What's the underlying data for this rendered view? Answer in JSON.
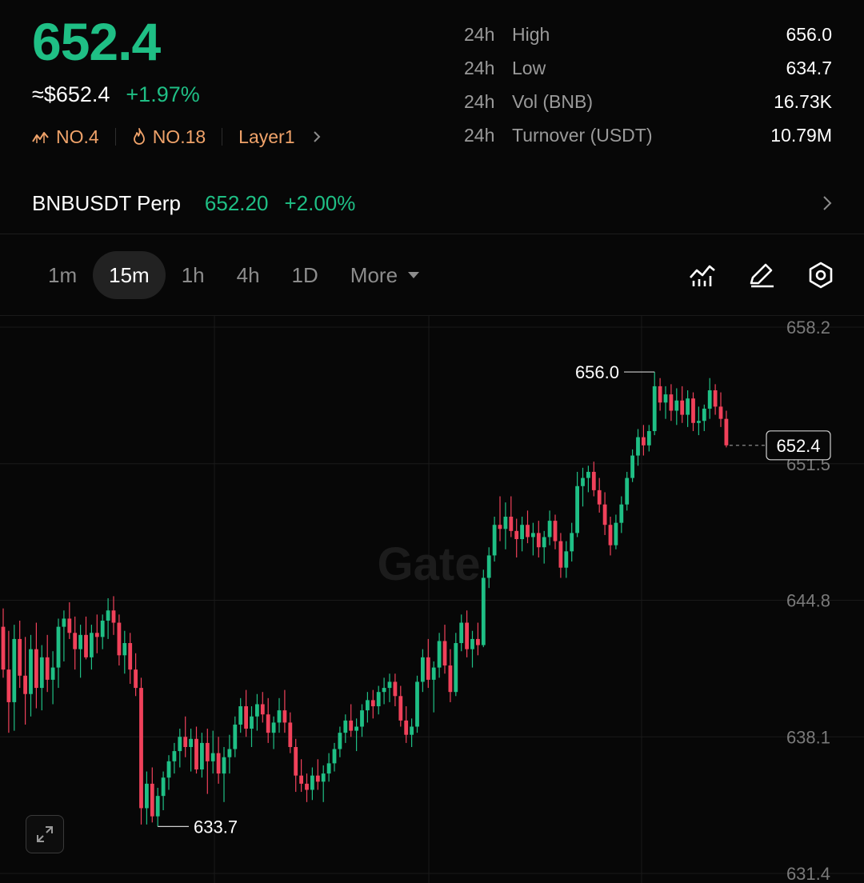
{
  "ticker": {
    "last_price": "652.4",
    "fiat_price": "≈$652.4",
    "change_pct": "+1.97%",
    "rank_market_cap": "NO.4",
    "rank_hot": "NO.18",
    "category": "Layer1"
  },
  "stats": [
    {
      "period": "24h",
      "label": "High",
      "value": "656.0"
    },
    {
      "period": "24h",
      "label": "Low",
      "value": "634.7"
    },
    {
      "period": "24h",
      "label": "Vol (BNB)",
      "value": "16.73K"
    },
    {
      "period": "24h",
      "label": "Turnover (USDT)",
      "value": "10.79M"
    }
  ],
  "perp": {
    "name": "BNBUSDT Perp",
    "price": "652.20",
    "change": "+2.00%"
  },
  "timeframes": {
    "items": [
      "1m",
      "15m",
      "1h",
      "4h",
      "1D"
    ],
    "active": "15m",
    "more_label": "More"
  },
  "tools": [
    "indicators-icon",
    "draw-icon",
    "settings-icon"
  ],
  "colors": {
    "up": "#1fbf85",
    "down": "#f0415a",
    "rank_orange": "#f0a36a",
    "background": "#070707"
  },
  "chart_data": {
    "type": "candlestick",
    "timeframe": "15m",
    "watermark": "Gate",
    "y_ticks": [
      "658.2",
      "651.5",
      "644.8",
      "638.1",
      "631.4"
    ],
    "ylim": [
      631.4,
      658.2
    ],
    "high_marker": "656.0",
    "low_marker": "633.7",
    "last_price_label": "652.4",
    "last_price": 652.4,
    "candles": [
      [
        643.5,
        644.4,
        641.0,
        641.4
      ],
      [
        641.4,
        643.3,
        638.3,
        639.8
      ],
      [
        639.8,
        643.6,
        638.4,
        642.9
      ],
      [
        642.9,
        643.8,
        640.5,
        641.1
      ],
      [
        641.1,
        643.0,
        638.7,
        640.2
      ],
      [
        640.2,
        643.1,
        639.1,
        642.4
      ],
      [
        642.4,
        643.7,
        639.5,
        640.5
      ],
      [
        640.5,
        642.6,
        639.4,
        642.0
      ],
      [
        642.0,
        643.1,
        640.3,
        640.9
      ],
      [
        640.9,
        642.3,
        639.7,
        641.5
      ],
      [
        641.5,
        643.9,
        640.5,
        643.5
      ],
      [
        643.5,
        644.3,
        641.8,
        643.9
      ],
      [
        643.9,
        644.7,
        642.9,
        643.2
      ],
      [
        643.2,
        644.0,
        641.4,
        642.4
      ],
      [
        642.4,
        643.6,
        641.0,
        643.1
      ],
      [
        643.1,
        644.0,
        641.9,
        642.0
      ],
      [
        642.0,
        643.6,
        641.4,
        643.2
      ],
      [
        643.2,
        644.1,
        642.2,
        643.0
      ],
      [
        643.0,
        644.1,
        642.4,
        643.8
      ],
      [
        643.8,
        644.9,
        642.9,
        644.3
      ],
      [
        644.3,
        645.0,
        643.1,
        643.7
      ],
      [
        643.7,
        644.1,
        641.6,
        642.1
      ],
      [
        642.1,
        643.3,
        641.2,
        642.7
      ],
      [
        642.7,
        643.2,
        640.7,
        641.4
      ],
      [
        641.4,
        642.2,
        640.1,
        640.5
      ],
      [
        640.5,
        641.0,
        633.8,
        634.6
      ],
      [
        634.6,
        636.4,
        633.8,
        635.8
      ],
      [
        635.8,
        636.6,
        633.9,
        634.2
      ],
      [
        634.2,
        635.6,
        633.7,
        635.2
      ],
      [
        635.2,
        636.4,
        634.5,
        636.1
      ],
      [
        636.1,
        637.2,
        635.5,
        636.9
      ],
      [
        636.9,
        637.8,
        636.3,
        637.4
      ],
      [
        637.4,
        638.5,
        636.6,
        638.1
      ],
      [
        638.1,
        639.1,
        637.1,
        637.6
      ],
      [
        637.6,
        638.5,
        636.4,
        638.0
      ],
      [
        638.0,
        638.6,
        636.3,
        636.5
      ],
      [
        636.5,
        638.3,
        636.1,
        637.8
      ],
      [
        637.8,
        638.5,
        635.3,
        636.9
      ],
      [
        636.9,
        638.4,
        636.3,
        637.3
      ],
      [
        637.3,
        638.1,
        635.8,
        636.3
      ],
      [
        636.3,
        637.6,
        634.9,
        637.1
      ],
      [
        637.1,
        638.2,
        636.3,
        637.5
      ],
      [
        637.5,
        639.1,
        637.1,
        638.7
      ],
      [
        638.7,
        640.0,
        638.3,
        639.6
      ],
      [
        639.6,
        640.4,
        638.1,
        638.5
      ],
      [
        638.5,
        639.6,
        637.6,
        639.1
      ],
      [
        639.1,
        640.2,
        638.4,
        639.7
      ],
      [
        639.7,
        640.3,
        638.8,
        639.2
      ],
      [
        639.2,
        640.0,
        637.8,
        638.3
      ],
      [
        638.3,
        639.1,
        637.5,
        638.8
      ],
      [
        638.8,
        640.0,
        638.3,
        639.4
      ],
      [
        639.4,
        640.4,
        638.3,
        638.8
      ],
      [
        638.8,
        639.3,
        637.3,
        637.6
      ],
      [
        637.6,
        638.0,
        635.4,
        636.2
      ],
      [
        636.2,
        637.0,
        635.4,
        635.8
      ],
      [
        635.8,
        636.3,
        634.9,
        635.5
      ],
      [
        635.5,
        636.6,
        635.0,
        636.2
      ],
      [
        636.2,
        637.0,
        635.5,
        635.9
      ],
      [
        635.9,
        636.7,
        634.9,
        636.3
      ],
      [
        636.3,
        637.3,
        635.9,
        636.8
      ],
      [
        636.8,
        637.8,
        636.4,
        637.5
      ],
      [
        637.5,
        638.6,
        637.1,
        638.3
      ],
      [
        638.3,
        639.2,
        637.8,
        638.9
      ],
      [
        638.9,
        639.7,
        638.1,
        638.4
      ],
      [
        638.4,
        639.0,
        637.4,
        638.6
      ],
      [
        638.6,
        639.7,
        638.1,
        639.4
      ],
      [
        639.4,
        640.3,
        638.8,
        639.9
      ],
      [
        639.9,
        640.4,
        639.0,
        639.6
      ],
      [
        639.6,
        640.6,
        639.2,
        640.3
      ],
      [
        640.3,
        641.0,
        639.7,
        640.5
      ],
      [
        640.5,
        641.2,
        639.8,
        640.8
      ],
      [
        640.8,
        641.2,
        639.6,
        640.1
      ],
      [
        640.1,
        640.6,
        638.6,
        638.9
      ],
      [
        638.9,
        639.6,
        637.8,
        638.2
      ],
      [
        638.2,
        639.0,
        637.6,
        638.6
      ],
      [
        638.6,
        641.1,
        638.3,
        640.8
      ],
      [
        640.8,
        642.4,
        640.3,
        642.0
      ],
      [
        642.0,
        642.9,
        640.5,
        640.9
      ],
      [
        640.9,
        641.8,
        639.3,
        641.5
      ],
      [
        641.5,
        643.2,
        641.0,
        642.8
      ],
      [
        642.8,
        643.6,
        641.2,
        641.6
      ],
      [
        641.6,
        642.4,
        639.8,
        640.3
      ],
      [
        640.3,
        643.2,
        640.1,
        642.7
      ],
      [
        642.7,
        644.1,
        642.3,
        643.7
      ],
      [
        643.7,
        644.3,
        642.0,
        642.4
      ],
      [
        642.4,
        643.3,
        641.5,
        642.9
      ],
      [
        642.9,
        643.7,
        642.1,
        642.6
      ],
      [
        642.6,
        646.3,
        642.5,
        645.9
      ],
      [
        645.9,
        647.4,
        645.4,
        647.0
      ],
      [
        647.0,
        648.9,
        646.7,
        648.5
      ],
      [
        648.5,
        649.9,
        647.7,
        648.3
      ],
      [
        648.3,
        649.6,
        647.3,
        648.9
      ],
      [
        648.9,
        649.9,
        647.9,
        648.2
      ],
      [
        648.2,
        648.8,
        646.9,
        647.8
      ],
      [
        647.8,
        648.9,
        647.2,
        648.5
      ],
      [
        648.5,
        649.2,
        647.6,
        647.9
      ],
      [
        647.9,
        648.6,
        647.0,
        648.1
      ],
      [
        648.1,
        648.7,
        646.9,
        647.4
      ],
      [
        647.4,
        648.2,
        646.6,
        647.9
      ],
      [
        647.9,
        649.2,
        647.5,
        648.7
      ],
      [
        648.7,
        649.0,
        647.3,
        647.7
      ],
      [
        647.7,
        648.1,
        645.9,
        646.4
      ],
      [
        646.4,
        647.7,
        645.9,
        647.2
      ],
      [
        647.2,
        648.6,
        646.7,
        648.1
      ],
      [
        648.1,
        651.1,
        647.9,
        650.4
      ],
      [
        650.4,
        651.3,
        649.4,
        650.8
      ],
      [
        650.8,
        651.4,
        650.1,
        651.1
      ],
      [
        651.1,
        651.6,
        649.9,
        650.2
      ],
      [
        650.2,
        650.8,
        649.1,
        649.5
      ],
      [
        649.5,
        650.1,
        648.0,
        648.5
      ],
      [
        648.5,
        648.9,
        647.0,
        647.5
      ],
      [
        647.5,
        649.0,
        647.3,
        648.6
      ],
      [
        648.6,
        649.9,
        648.1,
        649.5
      ],
      [
        649.5,
        651.1,
        649.2,
        650.8
      ],
      [
        650.8,
        652.2,
        650.6,
        651.9
      ],
      [
        651.9,
        653.2,
        651.4,
        652.8
      ],
      [
        652.8,
        653.4,
        651.9,
        652.4
      ],
      [
        652.4,
        653.4,
        652.1,
        653.1
      ],
      [
        653.1,
        656.0,
        652.9,
        655.3
      ],
      [
        655.3,
        655.7,
        654.1,
        654.5
      ],
      [
        654.5,
        655.3,
        653.7,
        654.9
      ],
      [
        654.9,
        655.4,
        653.6,
        654.1
      ],
      [
        654.1,
        655.2,
        653.4,
        654.6
      ],
      [
        654.6,
        655.3,
        653.5,
        653.9
      ],
      [
        653.9,
        655.1,
        653.3,
        654.7
      ],
      [
        654.7,
        655.0,
        653.1,
        653.5
      ],
      [
        653.5,
        654.3,
        652.9,
        653.6
      ],
      [
        653.6,
        654.4,
        653.1,
        654.2
      ],
      [
        654.2,
        655.7,
        653.7,
        655.1
      ],
      [
        655.1,
        655.4,
        653.9,
        654.3
      ],
      [
        654.3,
        655.0,
        653.3,
        653.7
      ],
      [
        653.7,
        654.1,
        652.3,
        652.4
      ]
    ]
  }
}
